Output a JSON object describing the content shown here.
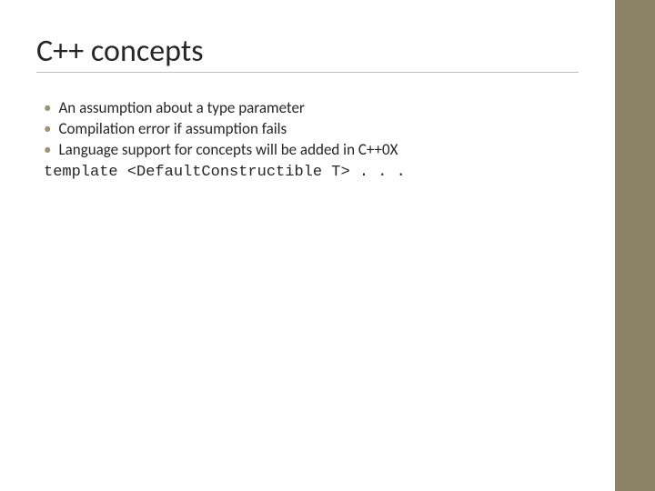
{
  "slide": {
    "title": "C++ concepts",
    "bullets": [
      "An assumption about a type parameter",
      "Compilation error if assumption fails",
      "Language support for concepts will be added in C++0X"
    ],
    "codeline": "template <DefaultConstructible T> . . ."
  },
  "colors": {
    "sidebar": "#8c8265",
    "bullet": "#9c9478",
    "underline": "#bfbfbf"
  }
}
